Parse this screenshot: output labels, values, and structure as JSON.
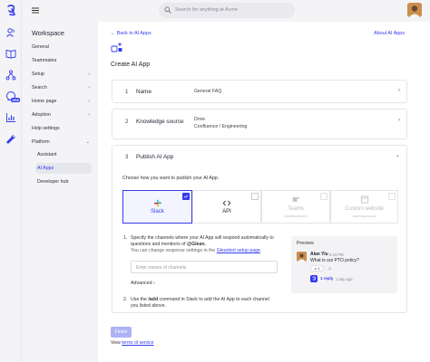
{
  "topbar": {
    "search_placeholder": "Search for anything at Acme"
  },
  "sidebar": {
    "title": "Workspace",
    "items": [
      {
        "label": "General",
        "chevron": false
      },
      {
        "label": "Teammates",
        "chevron": false
      },
      {
        "label": "Setup",
        "chevron": true
      },
      {
        "label": "Search",
        "chevron": true
      },
      {
        "label": "Home page",
        "chevron": true
      },
      {
        "label": "Adoption",
        "chevron": true
      },
      {
        "label": "Help settings",
        "chevron": false
      },
      {
        "label": "Platform",
        "chevron": true
      }
    ],
    "sub_items": [
      {
        "label": "Assistant",
        "active": false
      },
      {
        "label": "AI Apps",
        "active": true
      },
      {
        "label": "Developer hub",
        "active": false
      }
    ]
  },
  "rail": {
    "new_badge": "NEW"
  },
  "main": {
    "back_link": "Back to AI Apps",
    "about_link": "About AI Apps",
    "title": "Create AI App",
    "steps": [
      {
        "num": "1",
        "name": "Name",
        "value_lines": [
          "General FAQ"
        ]
      },
      {
        "num": "2",
        "name": "Knowledge source",
        "value_lines": [
          "Drive",
          "Confluence / Engineering"
        ]
      },
      {
        "num": "3",
        "name": "Publish AI App",
        "value_lines": []
      }
    ],
    "publish": {
      "choose_text": "Choose how you want to publish your AI App.",
      "options": [
        {
          "label": "Slack",
          "sub": "",
          "state": "selected",
          "icon": "slack-icon"
        },
        {
          "label": "API",
          "sub": "",
          "state": "available",
          "icon": "code-icon"
        },
        {
          "label": "Teams",
          "sub": "(coming soon)",
          "state": "disabled",
          "icon": "teams-icon"
        },
        {
          "label": "Custom website",
          "sub": "(coming soon)",
          "state": "disabled",
          "icon": "website-icon"
        }
      ],
      "instruction_1_num": "1.",
      "instruction_1_text_a": "Specify the channels where your AI App will respond automatically to questions and mentions of ",
      "instruction_1_mention": "@Glean.",
      "instruction_1_muted": "You can change response settings in the ",
      "instruction_1_link": "Gleanbot setup page",
      "instruction_1_muted_end": ".",
      "channel_placeholder": "Enter names of channels",
      "advanced_label": "Advanced",
      "instruction_2_num": "2.",
      "instruction_2_a": "Use the ",
      "instruction_2_cmd": "/add",
      "instruction_2_b": " command in Slack to add the AI App to each channel you listed above."
    },
    "preview": {
      "title": "Preview",
      "user_name": "Alan Yiu",
      "time": "5:23 PM",
      "message": "What is our PTO policy?",
      "reaction_count": "1",
      "replies": "1 reply",
      "reply_time": "1 day ago"
    },
    "finish_label": "Finish",
    "terms_prefix": "View ",
    "terms_link": "terms of service"
  },
  "colors": {
    "accent": "#343ced",
    "finish_disabled": "#aeb2f5",
    "sidebar_bg": "#f4f4f6"
  }
}
